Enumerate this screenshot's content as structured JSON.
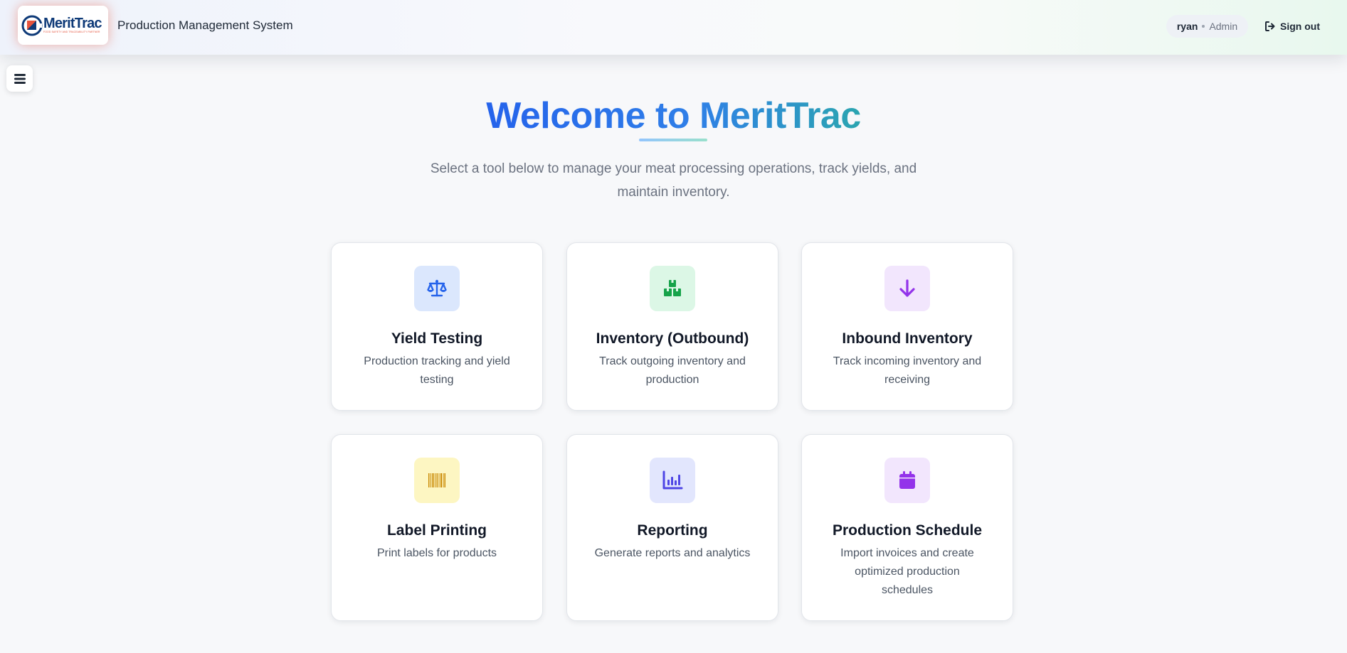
{
  "header": {
    "logo_text": "MeritTrac",
    "logo_tagline": "FOOD SAFETY AND TRACEABILITY PARTNER",
    "app_title": "Production Management System",
    "user_name": "ryan",
    "user_role": "Admin",
    "signout_label": "Sign out"
  },
  "hero": {
    "title": "Welcome to MeritTrac",
    "subtitle": "Select a tool below to manage your meat processing operations, track yields, and maintain inventory."
  },
  "colors": {
    "accent_blue": "#2563eb",
    "accent_teal": "#2ba5b0",
    "logo_orange": "#e5533d"
  },
  "tools": [
    {
      "title": "Yield Testing",
      "description": "Production tracking and yield testing",
      "icon": "scale-icon",
      "icon_bg": "#dbe7fd",
      "icon_color": "#2563eb"
    },
    {
      "title": "Inventory (Outbound)",
      "description": "Track outgoing inventory and production",
      "icon": "boxes-icon",
      "icon_bg": "#dcf7e6",
      "icon_color": "#16a34a"
    },
    {
      "title": "Inbound Inventory",
      "description": "Track incoming inventory and receiving",
      "icon": "arrow-down-icon",
      "icon_bg": "#f2e6fd",
      "icon_color": "#9333ea"
    },
    {
      "title": "Label Printing",
      "description": "Print labels for products",
      "icon": "barcode-icon",
      "icon_bg": "#fdf6c2",
      "icon_color": "#ca8a04"
    },
    {
      "title": "Reporting",
      "description": "Generate reports and analytics",
      "icon": "chart-icon",
      "icon_bg": "#e2e6fd",
      "icon_color": "#4f46e5"
    },
    {
      "title": "Production Schedule",
      "description": "Import invoices and create optimized production schedules",
      "icon": "calendar-icon",
      "icon_bg": "#f2e6fd",
      "icon_color": "#9333ea"
    }
  ]
}
